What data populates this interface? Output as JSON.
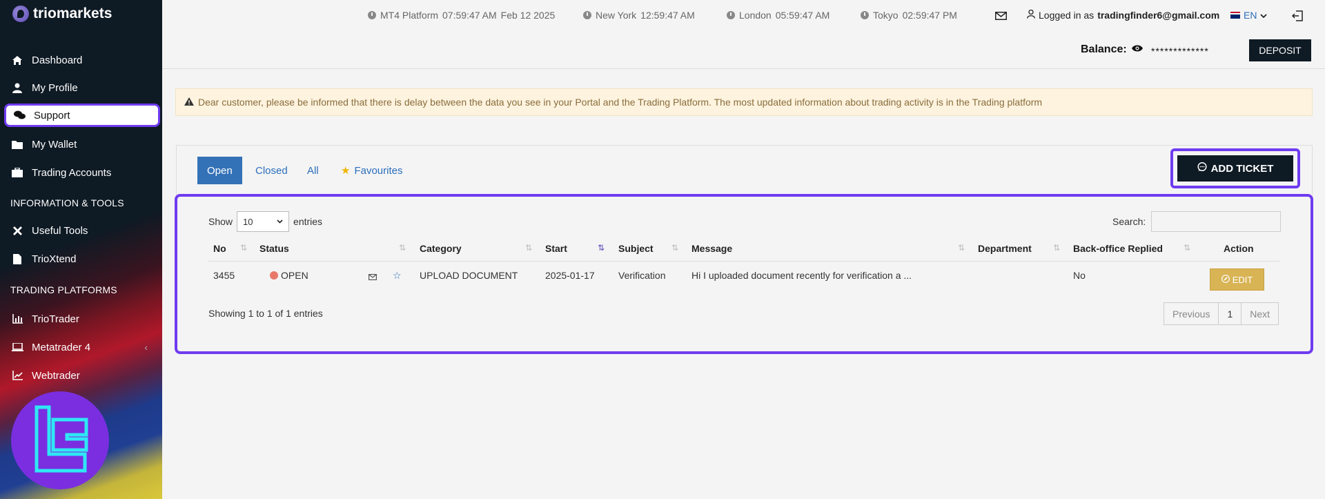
{
  "brand": {
    "name": "triomarkets"
  },
  "sidebar": {
    "items": [
      {
        "label": "Dashboard",
        "icon": "home-icon"
      },
      {
        "label": "My Profile",
        "icon": "user-icon"
      },
      {
        "label": "Support",
        "icon": "chat-icon",
        "active": true
      },
      {
        "label": "My Wallet",
        "icon": "folder-icon"
      },
      {
        "label": "Trading Accounts",
        "icon": "briefcase-icon"
      }
    ],
    "section_info": "INFORMATION & TOOLS",
    "info_items": [
      {
        "label": "Useful Tools",
        "icon": "tools-icon"
      },
      {
        "label": "TrioXtend",
        "icon": "file-icon"
      }
    ],
    "section_platforms": "TRADING PLATFORMS",
    "platform_items": [
      {
        "label": "TrioTrader",
        "icon": "bar-chart-icon"
      },
      {
        "label": "Metatrader 4",
        "icon": "laptop-icon"
      },
      {
        "label": "Webtrader",
        "icon": "line-chart-icon"
      }
    ]
  },
  "topbar": {
    "clocks": [
      {
        "label": "MT4 Platform",
        "time": "07:59:47 AM",
        "date": "Feb 12 2025"
      },
      {
        "label": "New York",
        "time": "12:59:47 AM"
      },
      {
        "label": "London",
        "time": "05:59:47 AM"
      },
      {
        "label": "Tokyo",
        "time": "02:59:47 PM"
      }
    ],
    "logged_in_prefix": "Logged in as",
    "user_email": "tradingfinder6@gmail.com",
    "language": "EN",
    "balance_label": "Balance:",
    "balance_masked": "*************",
    "deposit_label": "DEPOSIT"
  },
  "notice": {
    "text": "Dear customer, please be informed that there is delay between the data you see in your Portal and the Trading Platform. The most updated information about trading activity is in the Trading platform"
  },
  "tabs": [
    "Open",
    "Closed",
    "All",
    "Favourites"
  ],
  "add_ticket_label": "ADD TICKET",
  "table": {
    "show_label": "Show",
    "entries_label": "entries",
    "page_size": "10",
    "search_label": "Search:",
    "columns": [
      "No",
      "Status",
      "Category",
      "Start",
      "Subject",
      "Message",
      "Department",
      "Back-office Replied",
      "Action"
    ],
    "rows": [
      {
        "no": "3455",
        "status": "OPEN",
        "category": "UPLOAD DOCUMENT",
        "start": "2025-01-17",
        "subject": "Verification",
        "message": "Hi I uploaded document recently for verification a ...",
        "department": "",
        "replied": "No",
        "action": "EDIT"
      }
    ],
    "summary": "Showing 1 to 1 of 1 entries",
    "pagination": {
      "previous": "Previous",
      "current": "1",
      "next": "Next"
    }
  },
  "colors": {
    "accent": "#6f3bf0",
    "primary": "#3472b8",
    "dark": "#0e1a24",
    "edit": "#d9b455"
  }
}
